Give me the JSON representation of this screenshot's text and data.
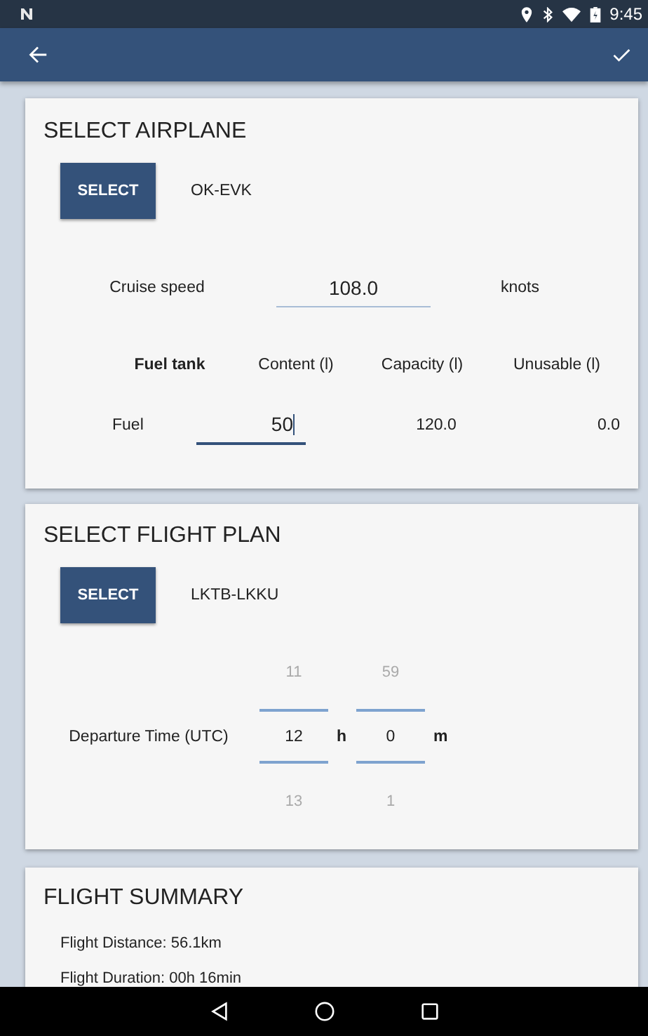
{
  "status_bar": {
    "time": "9:45"
  },
  "airplane": {
    "title": "SELECT AIRPLANE",
    "button": "SELECT",
    "registration": "OK-EVK",
    "cruise_speed": {
      "label": "Cruise speed",
      "value": "108.0",
      "focused": false,
      "unit": "knots"
    },
    "fuel_table": {
      "columns": [
        "Fuel tank",
        "Content (l)",
        "Capacity (l)",
        "Unusable (l)"
      ],
      "rows": [
        {
          "tank": "Fuel",
          "content": "50",
          "focused": true,
          "capacity": "120.0",
          "unusable": "0.0"
        }
      ]
    }
  },
  "flight_plan": {
    "title": "SELECT FLIGHT PLAN",
    "button": "SELECT",
    "route": "LKTB-LKKU",
    "departure": {
      "label": "Departure Time (UTC)",
      "hour": {
        "previous": "11",
        "value": "12",
        "next": "13",
        "unit": "h"
      },
      "minute": {
        "previous": "59",
        "value": "0",
        "next": "1",
        "unit": "m"
      }
    }
  },
  "summary": {
    "title": "FLIGHT SUMMARY",
    "lines": [
      "Flight Distance: 56.1km",
      "Flight Duration: 00h 16min"
    ]
  }
}
